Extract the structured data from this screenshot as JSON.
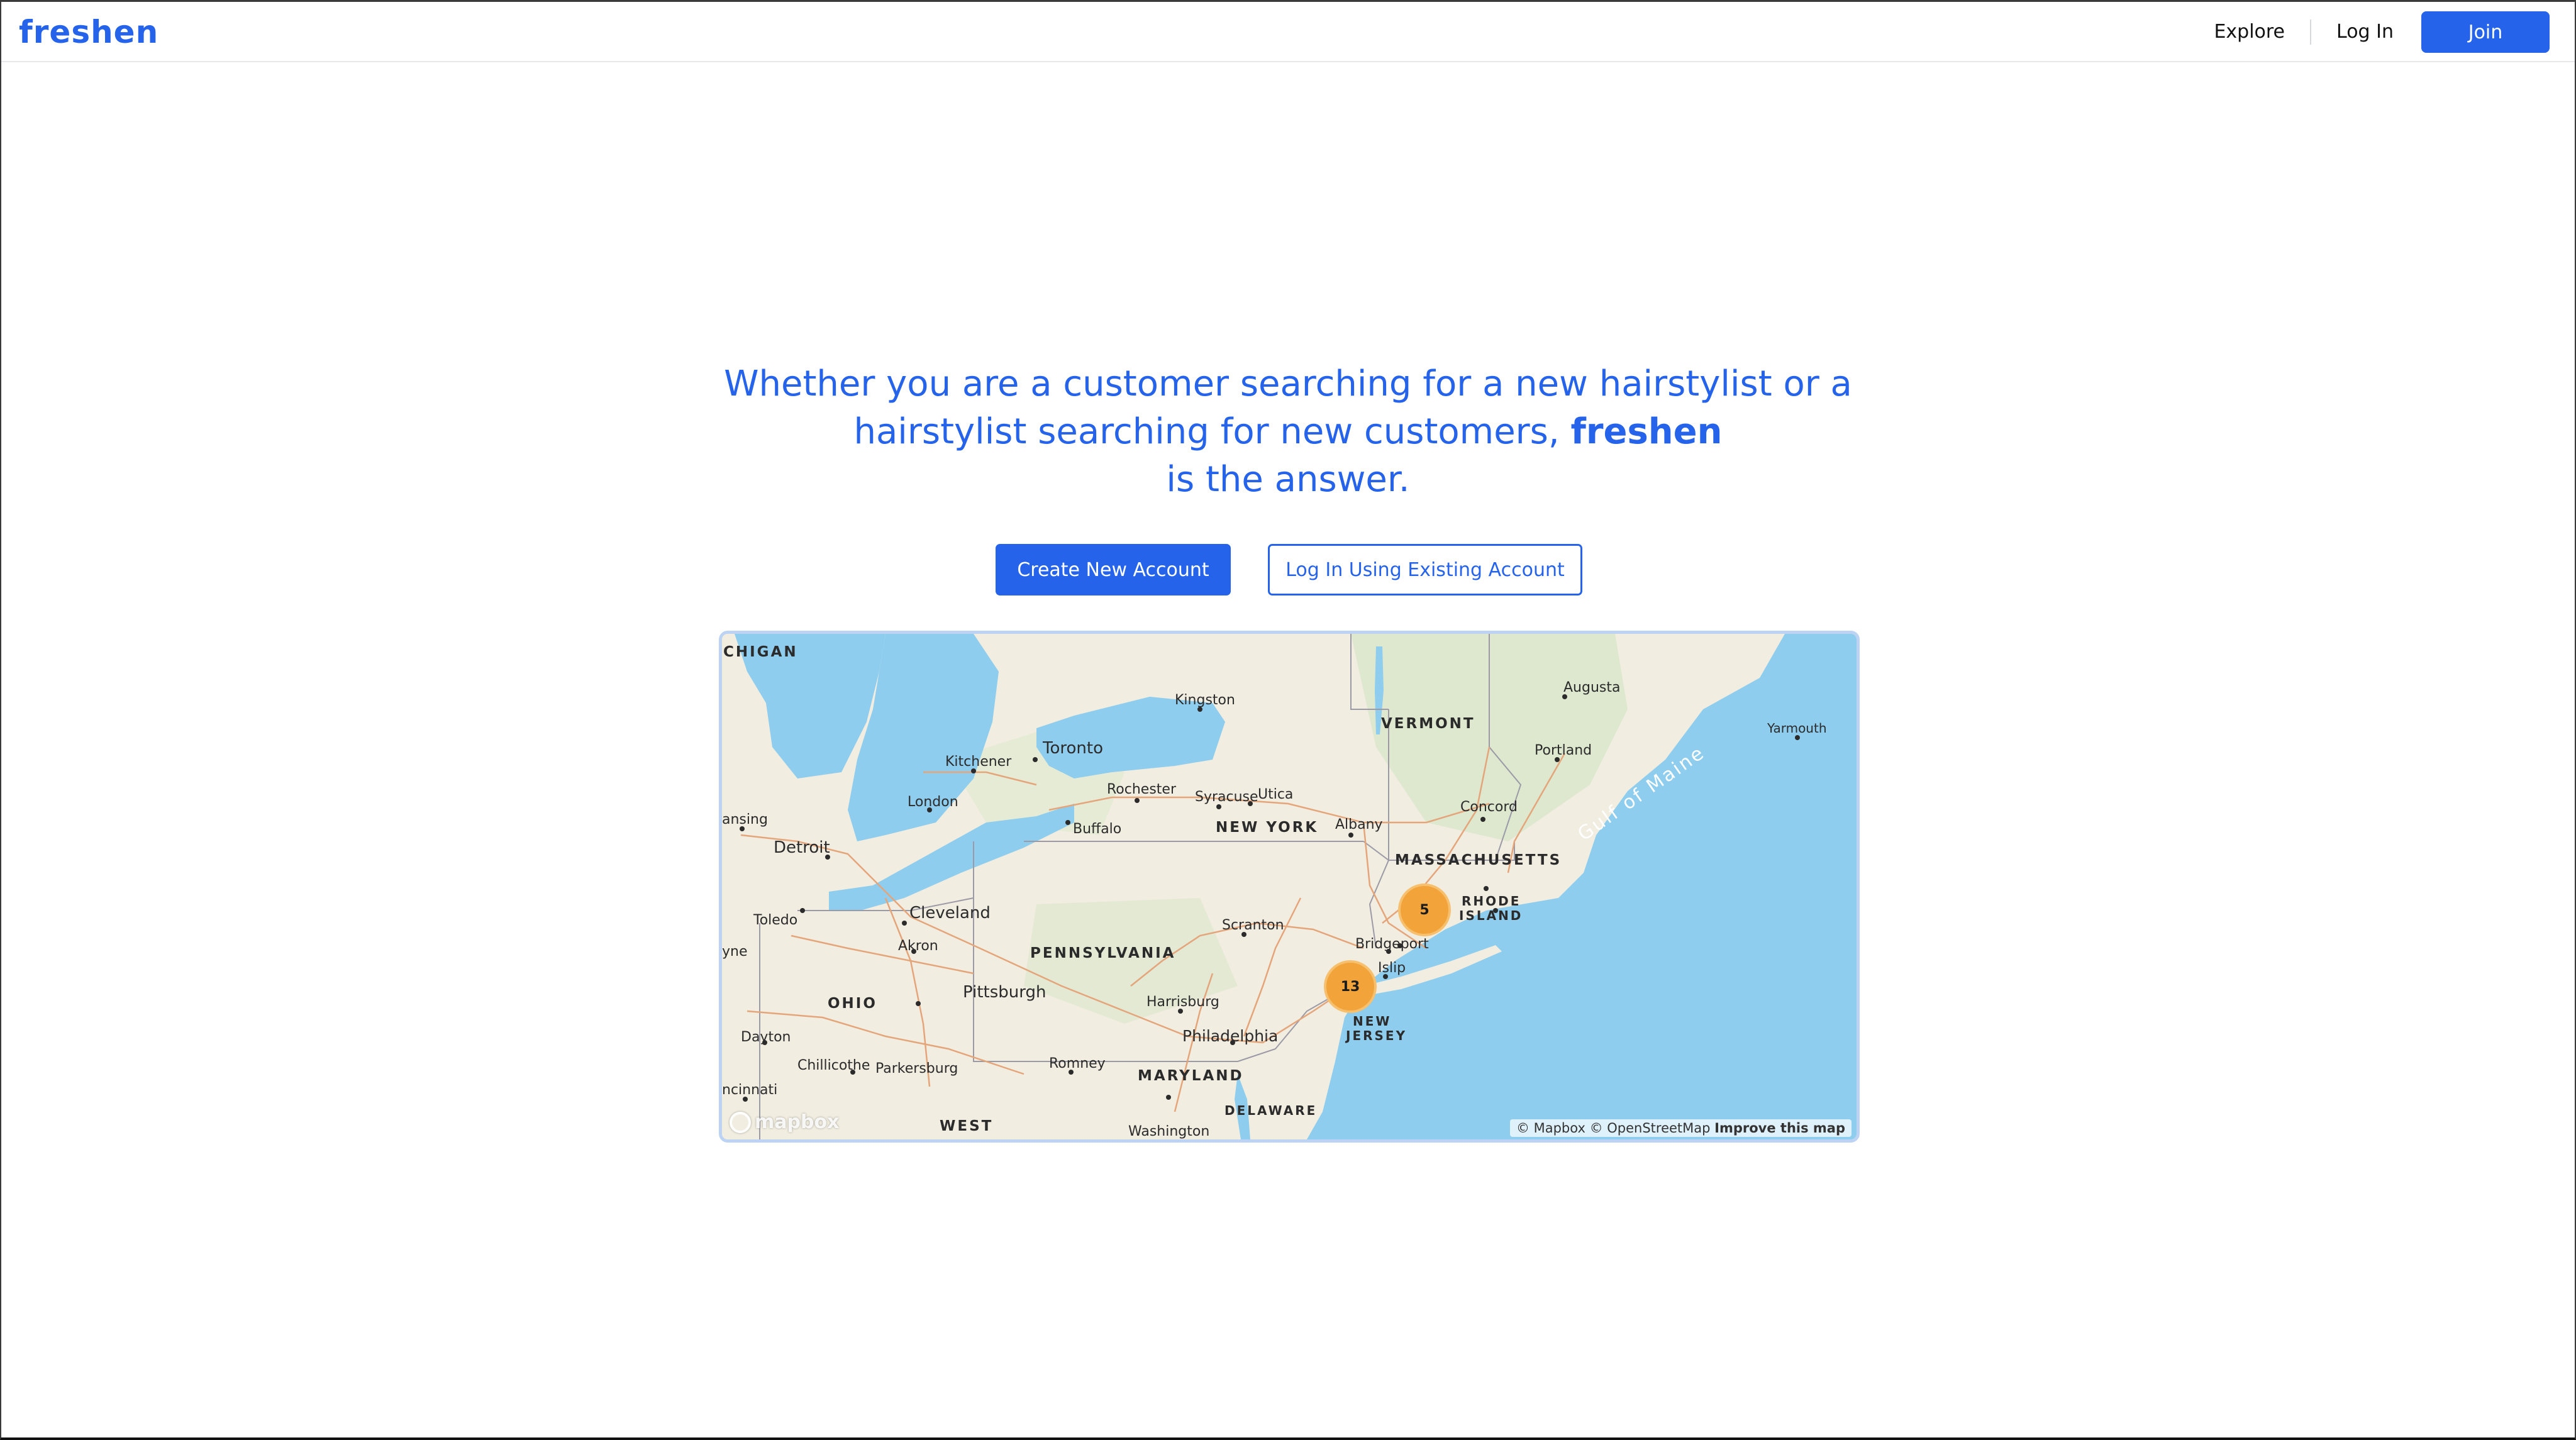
{
  "header": {
    "brand": "freshen",
    "nav": {
      "explore": "Explore",
      "login": "Log In",
      "join": "Join"
    }
  },
  "hero": {
    "line1": "Whether you are a customer searching for a new hairstylist or a",
    "line2_prefix": "hairstylist searching for new customers,",
    "line2_brand": "freshen",
    "line3": "is the answer."
  },
  "actions": {
    "create_account": "Create New Account",
    "login_existing": "Log In Using Existing Account"
  },
  "map": {
    "labels": {
      "michigan": "CHIGAN",
      "kingston": "Kingston",
      "augusta": "Augusta",
      "vermont": "VERMONT",
      "yarmouth": "Yarmouth",
      "toronto": "Toronto",
      "kitchener": "Kitchener",
      "portland": "Portland",
      "rochester": "Rochester",
      "concord": "Concord",
      "syracuse": "Syracuse",
      "utica": "Utica",
      "london": "London",
      "lansing": "ansing",
      "buffalo": "Buffalo",
      "albany": "Albany",
      "new_york": "NEW YORK",
      "gulf_of_maine": "Gulf of Maine",
      "detroit": "Detroit",
      "massachusetts": "MASSACHUSETTS",
      "cleveland": "Cleveland",
      "toledo": "Toledo",
      "rhode_island_1": "RHODE",
      "rhode_island_2": "ISLAND",
      "scranton": "Scranton",
      "wayne": "yne",
      "akron": "Akron",
      "pennsylvania": "PENNSYLVANIA",
      "bridgeport": "Bridgeport",
      "islip": "Islip",
      "pittsburgh": "Pittsburgh",
      "ohio": "OHIO",
      "harrisburg": "Harrisburg",
      "new_jersey_1": "NEW",
      "new_jersey_2": "JERSEY",
      "dayton": "Dayton",
      "philadelphia": "Philadelphia",
      "chillicothe": "Chillicothe",
      "parkersburg": "Parkersburg",
      "romney": "Romney",
      "maryland": "MARYLAND",
      "cincinnati": "ncinnati",
      "delaware": "DELAWARE",
      "west_virginia": "WEST",
      "washington": "Washington"
    },
    "clusters": [
      {
        "count": "5"
      },
      {
        "count": "13"
      }
    ],
    "logo": "mapbox",
    "attribution": "© Mapbox © OpenStreetMap",
    "improve": "Improve this map"
  },
  "colors": {
    "brand": "#2563eb",
    "water": "#8ecdee",
    "land": "#f1ede0",
    "cluster": "#f2a33a"
  }
}
